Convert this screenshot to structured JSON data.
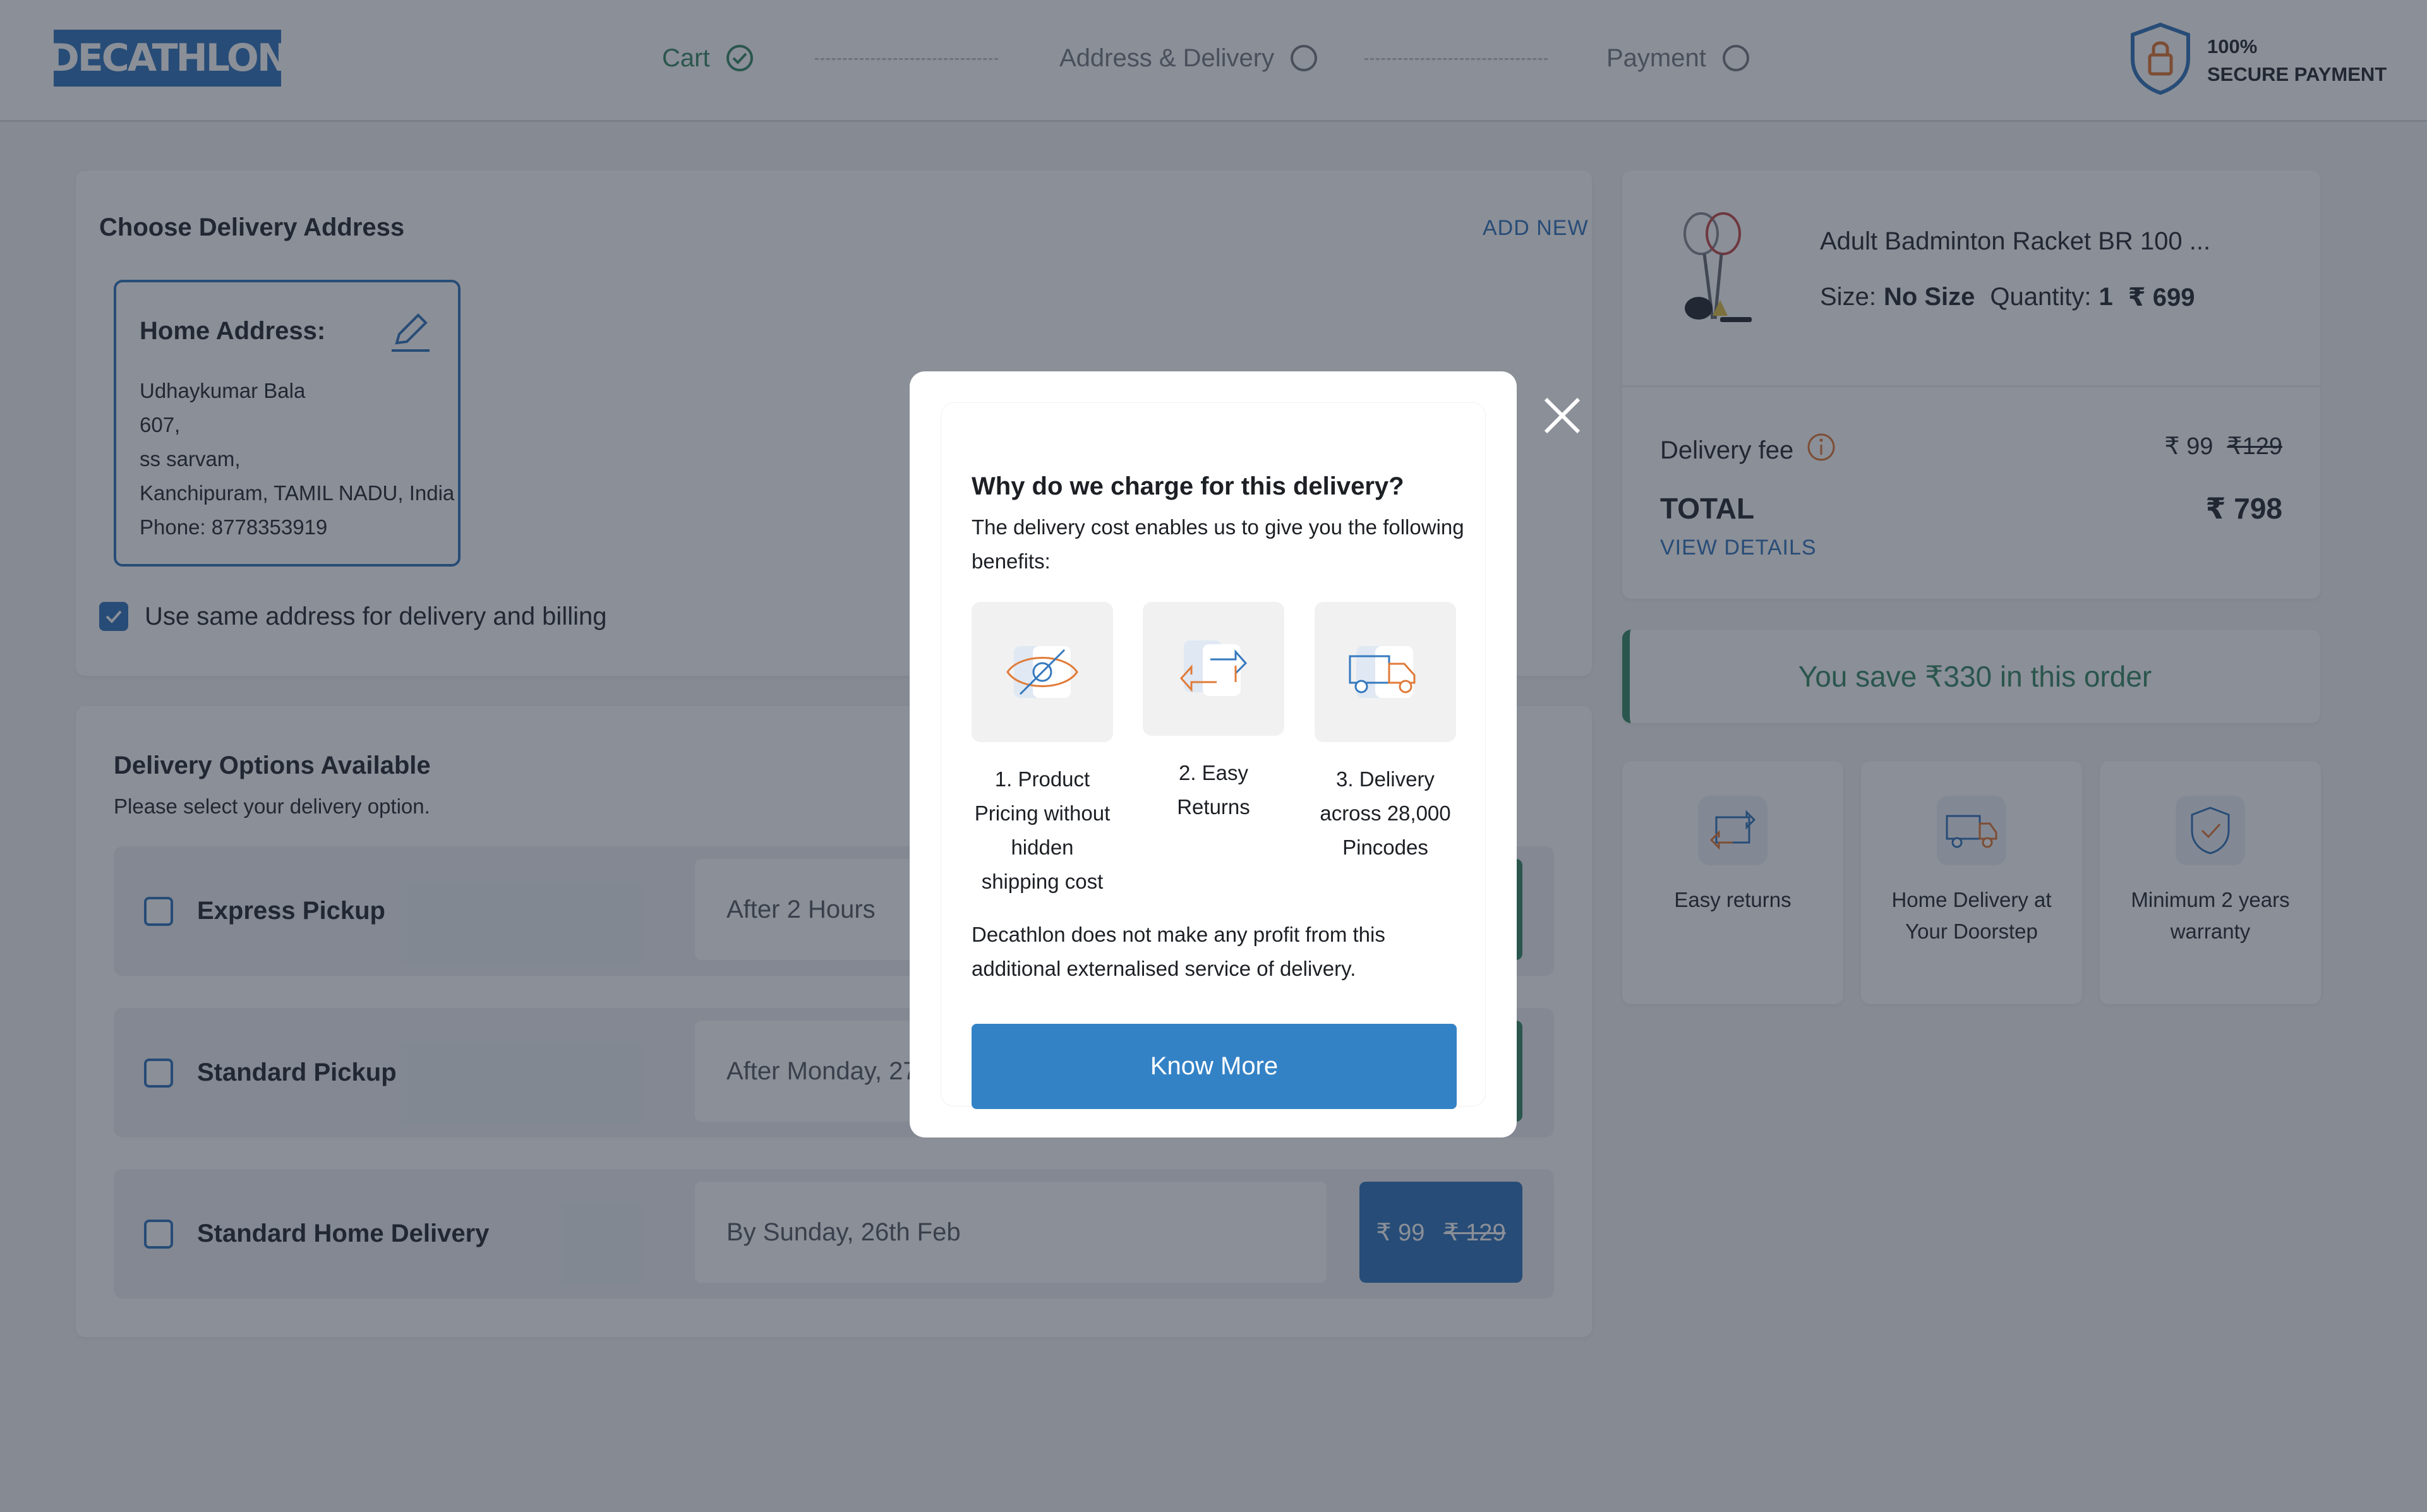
{
  "header": {
    "logo": "DECATHLON",
    "steps": [
      {
        "label": "Cart",
        "state": "done"
      },
      {
        "label": "Address & Delivery",
        "state": "current"
      },
      {
        "label": "Payment",
        "state": "pending"
      }
    ],
    "secure_line1": "100%",
    "secure_line2": "SECURE PAYMENT"
  },
  "address": {
    "title": "Choose Delivery Address",
    "add_new": "ADD NEW",
    "card_title": "Home Address:",
    "lines": [
      "Udhaykumar Bala",
      "607,",
      "ss sarvam,",
      "Kanchipuram, TAMIL NADU, India",
      "Phone: 8778353919"
    ],
    "same_address_label": "Use same address for delivery and billing",
    "same_address_checked": true
  },
  "delivery": {
    "title": "Delivery Options Available",
    "subtitle": "Please select your delivery option.",
    "options": [
      {
        "name": "Express Pickup",
        "date": "After 2 Hours",
        "price": "",
        "mrp": ""
      },
      {
        "name": "Standard Pickup",
        "date": "After Monday, 27th Feb",
        "price": "",
        "mrp": ""
      },
      {
        "name": "Standard Home Delivery",
        "date": "By Sunday, 26th Feb",
        "price": "₹ 99",
        "mrp": "₹ 129"
      }
    ]
  },
  "summary": {
    "product_name": "Adult Badminton Racket BR 100 ...",
    "size_label": "Size:",
    "size_value": "No Size",
    "qty_label": "Quantity:",
    "qty_value": "1",
    "product_price": "₹ 699",
    "delivery_fee_label": "Delivery fee",
    "delivery_fee": "₹ 99",
    "delivery_fee_mrp": "₹129",
    "total_label": "TOTAL",
    "total_value": "₹ 798",
    "view_details": "VIEW DETAILS",
    "savings": "You save ₹330 in this order"
  },
  "features": [
    {
      "label": "Easy returns",
      "icon": "returns-icon"
    },
    {
      "label": "Home Delivery at Your Doorstep",
      "icon": "delivery-truck-icon"
    },
    {
      "label": "Minimum 2 years warranty",
      "icon": "warranty-shield-icon"
    }
  ],
  "modal": {
    "title": "Why do we charge for this delivery?",
    "description": "The delivery cost enables us to give you the following benefits:",
    "benefits": [
      {
        "label": "1. Product Pricing without hidden shipping cost",
        "icon": "hidden-eye-icon"
      },
      {
        "label": "2. Easy Returns",
        "icon": "returns-icon"
      },
      {
        "label": "3. Delivery across 28,000 Pincodes",
        "icon": "delivery-truck-icon"
      }
    ],
    "note": "Decathlon does not make any profit from this additional externalised service of delivery.",
    "button": "Know More"
  },
  "colors": {
    "brand_blue": "#3679be",
    "success_green": "#3c8d6a",
    "accent_orange": "#e07b39",
    "overlay": "rgba(23,32,48,0.5)"
  }
}
